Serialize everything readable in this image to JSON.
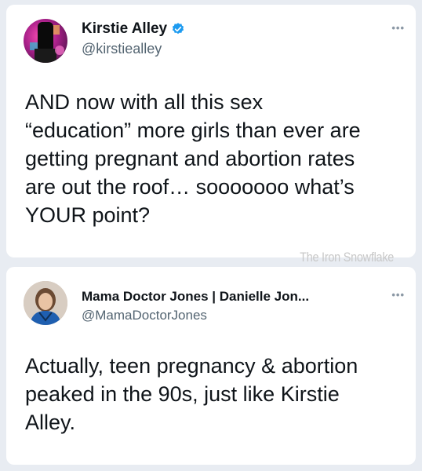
{
  "tweets": [
    {
      "display_name": "Kirstie Alley",
      "handle": "@kirstiealley",
      "verified": true,
      "verified_icon": "verified-badge-icon",
      "more_icon": "more-options-icon",
      "avatar": "user-avatar",
      "text": "AND now with all this sex\n“education” more girls than ever are\ngetting pregnant and abortion rates\nare out the roof… sooooooo what’s\nYOUR point?"
    },
    {
      "display_name": "Mama Doctor Jones | Danielle Jon...",
      "handle": "@MamaDoctorJones",
      "verified": false,
      "more_icon": "more-options-icon",
      "avatar": "user-avatar",
      "text": "Actually, teen pregnancy & abortion\npeaked in the 90s, just like Kirstie\nAlley."
    }
  ],
  "watermark": "The Iron Snowflake",
  "colors": {
    "background": "#e8ecf2",
    "card": "#ffffff",
    "text": "#0f1419",
    "secondary_text": "#536471",
    "verified_blue": "#1d9bf0"
  }
}
